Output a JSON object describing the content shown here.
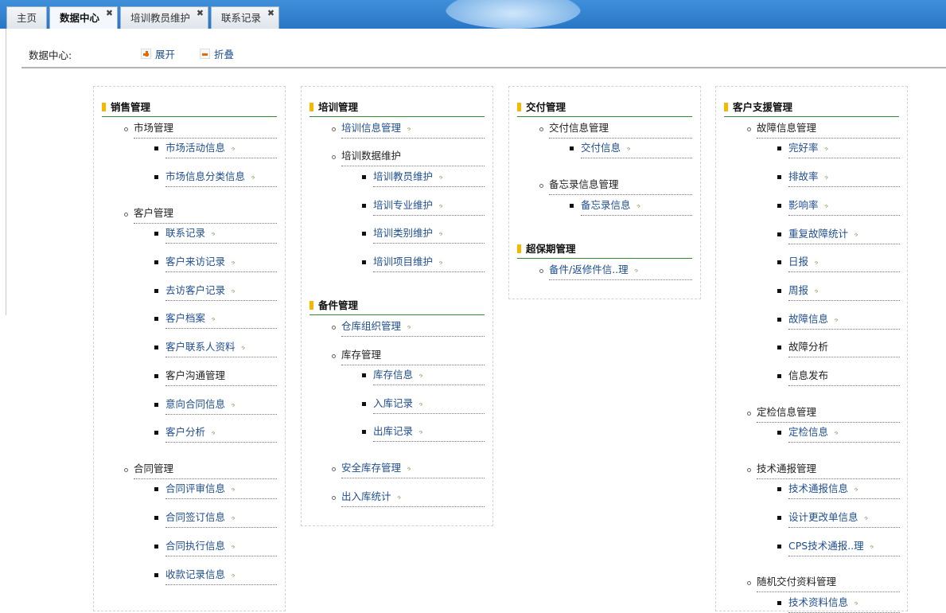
{
  "tabs": {
    "home": "主页",
    "data_center": "数据中心",
    "trainer_maintenance": "培训教员维护",
    "contact_records": "联系记录",
    "close_glyph": "✖"
  },
  "toolbar": {
    "title": "数据中心:",
    "expand": "展开",
    "collapse": "折叠"
  },
  "arrow_glyph": "·›",
  "columns": {
    "c1": {
      "header": "销售管理",
      "items": [
        "市场管理",
        "市场活动信息",
        "市场信息分类信息",
        "客户管理",
        "联系记录",
        "客户来访记录",
        "去访客户记录",
        "客户档案",
        "客户联系人资料",
        "客户沟通管理",
        "意向合同信息",
        "客户分析",
        "合同管理",
        "合同评审信息",
        "合同签订信息",
        "合同执行信息",
        "收款记录信息"
      ]
    },
    "c2": {
      "header": "培训管理",
      "header2": "备件管理",
      "items": [
        "培训信息管理",
        "培训数据维护",
        "培训教员维护",
        "培训专业维护",
        "培训类别维护",
        "培训项目维护",
        "仓库组织管理",
        "库存管理",
        "库存信息",
        "入库记录",
        "出库记录",
        "安全库存管理",
        "出入库统计"
      ]
    },
    "c3": {
      "header": "交付管理",
      "header2": "超保期管理",
      "items": [
        "交付信息管理",
        "交付信息",
        "备忘录信息管理",
        "备忘录信息",
        "备件/返修件信..理"
      ]
    },
    "c4": {
      "header": "客户支援管理",
      "items": [
        "故障信息管理",
        "完好率",
        "排故率",
        "影响率",
        "重复故障统计",
        "日报",
        "周报",
        "故障信息",
        "故障分析",
        "信息发布",
        "定检信息管理",
        "定检信息",
        "技术通报管理",
        "技术通报信息",
        "设计更改单信息",
        "CPS技术通报..理",
        "随机交付资料管理",
        "技术资料信息"
      ]
    }
  }
}
